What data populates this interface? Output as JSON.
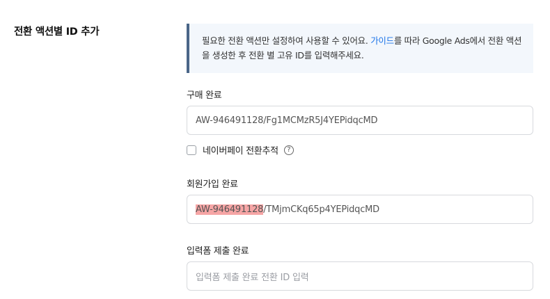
{
  "section": {
    "title": "전환 액션별 ID 추가"
  },
  "info": {
    "text_before": "필요한 전환 액션만 설정하여 사용할 수 있어요.  ",
    "link_text": "가이드",
    "text_after": "를 따라 Google Ads에서 전환 액션을 생성한 후 전환 별 고유 ID를 입력해주세요."
  },
  "fields": {
    "purchase": {
      "label": "구매 완료",
      "value": "AW-946491128/Fg1MCMzR5J4YEPidqcMD"
    },
    "naverpay": {
      "label": "네이버페이 전환추적",
      "checked": false
    },
    "signup": {
      "label": "회원가입 완료",
      "value_highlight": "AW-946491128",
      "value_rest": "/TMjmCKq65p4YEPidqcMD"
    },
    "form_submit": {
      "label": "입력폼 제출 완료",
      "placeholder": "입력폼 제출 완료 전환 ID 입력"
    }
  },
  "icons": {
    "help": "question-circle-icon"
  },
  "colors": {
    "link": "#1a73e8",
    "info_bg": "#f3f7fc",
    "info_border": "#4a6688",
    "highlight": "#f6a5a5"
  }
}
